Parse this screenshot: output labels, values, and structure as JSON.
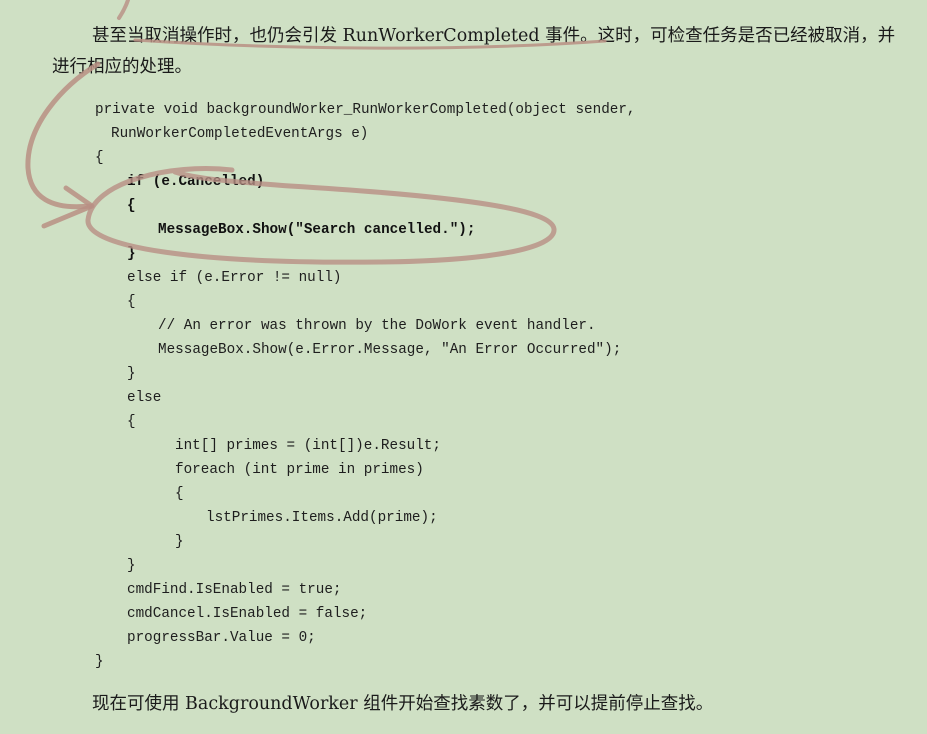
{
  "intro_paragraph": "甚至当取消操作时，也仍会引发 RunWorkerCompleted 事件。这时，可检查任务是否已经被取消，并进行相应的处理。",
  "code_lines": [
    "private void backgroundWorker_RunWorkerCompleted(object sender,",
    "RunWorkerCompletedEventArgs e)",
    "{",
    "if (e.Cancelled)",
    "{",
    "MessageBox.Show(\"Search cancelled.\");",
    "}",
    "else if (e.Error != null)",
    "{",
    "// An error was thrown by the DoWork event handler.",
    "MessageBox.Show(e.Error.Message, \"An Error Occurred\");",
    "}",
    "else",
    "{",
    "int[] primes = (int[])e.Result;",
    "foreach (int prime in primes)",
    "{",
    "lstPrimes.Items.Add(prime);",
    "}",
    "}",
    "cmdFind.IsEnabled = true;",
    "cmdCancel.IsEnabled = false;",
    "progressBar.Value = 0;",
    "}"
  ],
  "closing_paragraph": "现在可使用 BackgroundWorker 组件开始查找素数了，并可以提前停止查找。",
  "annotation_color": "#b88f84"
}
